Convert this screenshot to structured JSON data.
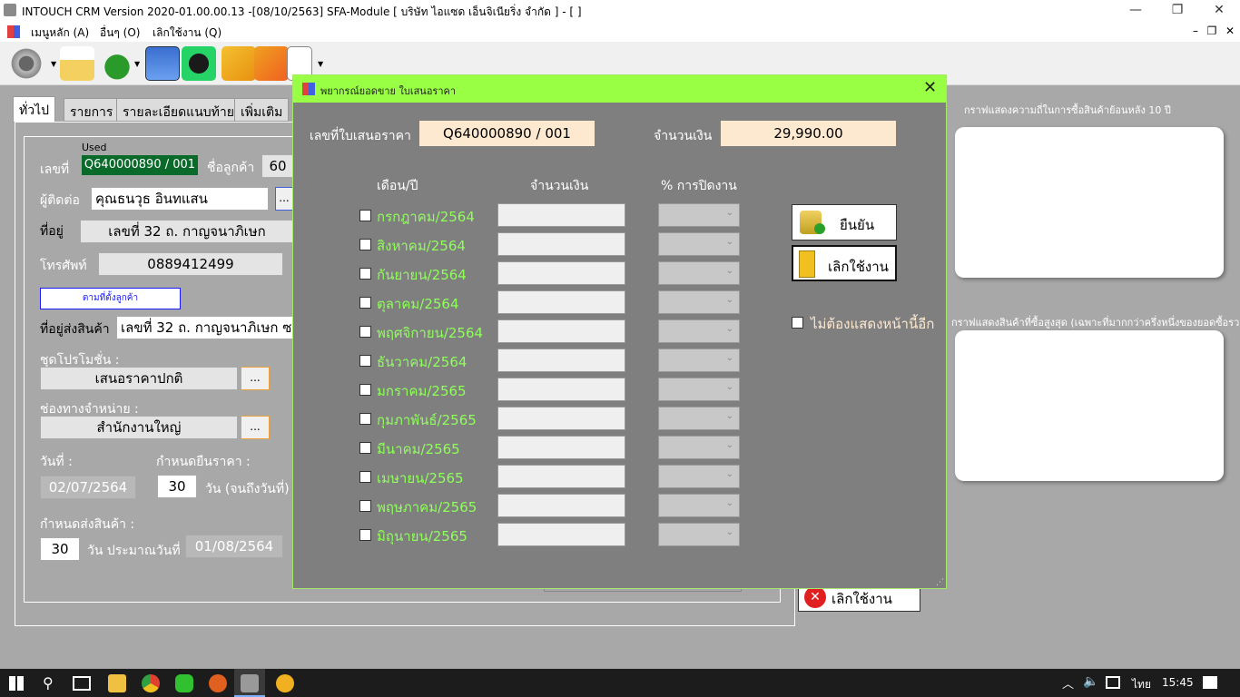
{
  "window": {
    "title": "INTOUCH CRM Version 2020-01.00.00.13 -[08/10/2563] SFA-Module  [ บริษัท ไอแซด เอ็นจิเนียริ่ง จำกัด ] - [ ]",
    "minimize": "—",
    "maximize": "❐",
    "close": "✕"
  },
  "menu": {
    "items": [
      "เมนูหลัก (A)",
      "อื่นๆ (O)",
      "เลิกใช้งาน (Q)"
    ],
    "mdi_min": "–",
    "mdi_restore": "❐",
    "mdi_close": "✕"
  },
  "form": {
    "tabs": [
      "ทั่วไป",
      "รายการ",
      "รายละเอียดแนบท้าย",
      "เพิ่มเติม"
    ],
    "used_label": "Used",
    "doc_no_label": "เลขที่",
    "doc_no": "Q640000890 / 001",
    "customer_label": "ชื่อลูกค้า",
    "customer_value": "60",
    "contact_label": "ผู้ติดต่อ",
    "contact_value": "คุณธนวุธ อินทแสน",
    "contact_btn": "...",
    "address_label": "ที่อยู่",
    "address_value": "เลขที่  32  ถ. กาญจนาภิเษก",
    "phone_label": "โทรศัพท์",
    "phone_value": "0889412499",
    "same_as_customer": "ตามที่ตั้งลูกค้า",
    "ship_label": "ที่อยู่ส่งสินค้า",
    "ship_value": "เลขที่  32  ถ. กาญจนาภิเษก  ซ.",
    "promo_label": "ชุดโปรโมชั่น :",
    "promo_value": "เสนอราคาปกติ",
    "promo_btn": "...",
    "channel_label": "ช่องทางจำหน่าย  :",
    "channel_value": "สำนักงานใหญ่",
    "channel_btn": "...",
    "date_label": "วันที่ :",
    "date_value": "02/07/2564",
    "valid_label": "กำหนดยืนราคา :",
    "valid_days": "30",
    "valid_suffix": "วัน (จนถึงวันที่)",
    "delivery_label": "กำหนดส่งสินค้า :",
    "delivery_days": "30",
    "delivery_suffix": "วัน ประมาณวันที่",
    "delivery_date": "01/08/2564",
    "cancel_btn": "เลิกใช้งาน"
  },
  "charts": {
    "top_label": "กราฟแสดงความถี่ในการซื้อสินค้าย้อนหลัง 10 ปี",
    "bottom_label": "กราฟแสดงสินค้าที่ซื้อสูงสุด (เฉพาะที่มากกว่าครึ่งหนึ่งของยอดซื้อรวม"
  },
  "dialog": {
    "title": "พยากรณ์ยอดขาย ใบเสนอราคา",
    "close": "✕",
    "quote_no_label": "เลขที่ใบเสนอราคา",
    "quote_no": "Q640000890 / 001",
    "amount_label": "จำนวนเงิน",
    "amount": "29,990.00",
    "col_month": "เดือน/ปี",
    "col_amount": "จำนวนเงิน",
    "col_pct": "% การปิดงาน",
    "months": [
      "กรกฎาคม/2564",
      "สิงหาคม/2564",
      "กันยายน/2564",
      "ตุลาคม/2564",
      "พฤศจิกายน/2564",
      "ธันวาคม/2564",
      "มกราคม/2565",
      "กุมภาพันธ์/2565",
      "มีนาคม/2565",
      "เมษายน/2565",
      "พฤษภาคม/2565",
      "มิถุนายน/2565"
    ],
    "confirm_btn": "ยืนยัน",
    "cancel_btn": "เลิกใช้งาน",
    "dont_show": "ไม่ต้องแสดงหน้านี้อีก"
  },
  "taskbar": {
    "lang": "ไทย",
    "time": "15:45"
  },
  "colors": {
    "dialog_title": "#99ff44",
    "month_text": "#8fff5a",
    "doc_no_bg": "#0a6a2a",
    "highlight_box": "#fde9d0"
  }
}
